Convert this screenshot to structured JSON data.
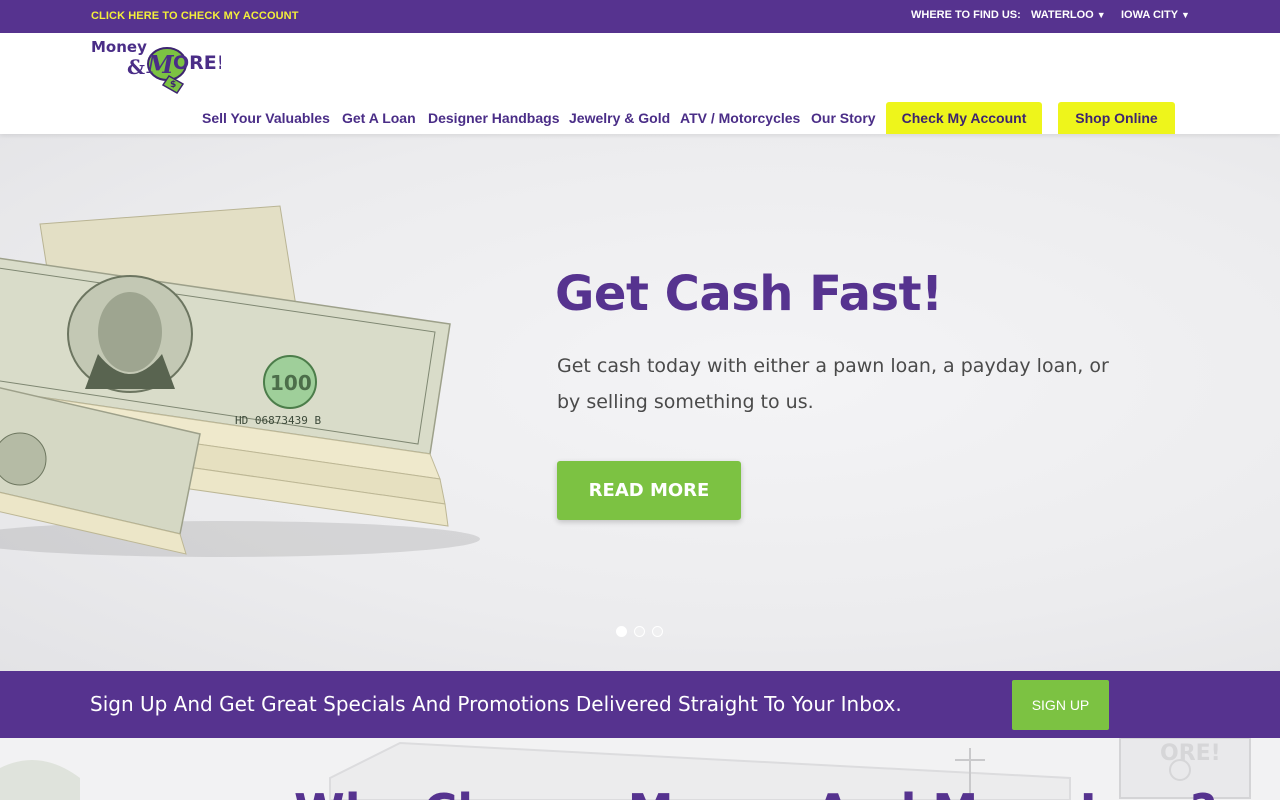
{
  "topbar": {
    "account_link": "CLICK HERE TO CHECK MY ACCOUNT",
    "find_us_label": "WHERE TO FIND US:",
    "locations": [
      {
        "label": "WATERLOO",
        "caret": "▼"
      },
      {
        "label": "IOWA CITY",
        "caret": "▼"
      }
    ]
  },
  "header": {
    "logo": {
      "line1": "Money",
      "amp": "&",
      "line2": "ORE!",
      "m_letter": "M",
      "tag": "$"
    },
    "nav": [
      "Sell Your Valuables",
      "Get A Loan",
      "Designer Handbags",
      "Jewelry & Gold",
      "ATV / Motorcycles",
      "Our Story"
    ],
    "check_account_button": "Check My Account",
    "shop_online_button": "Shop Online"
  },
  "hero": {
    "title": "Get Cash Fast!",
    "subtitle": "Get cash today with either a pawn loan, a payday loan, or by selling something to us.",
    "cta": "READ MORE",
    "bill_numbers": [
      "100",
      "HD 06873439 B"
    ],
    "slides_total": 3,
    "active_slide": 1
  },
  "signup": {
    "text": "Sign Up And Get Great Specials And Promotions Delivered Straight To Your Inbox.",
    "button": "SIGN UP"
  },
  "bottom": {
    "heading": "Why Choose Money And More Inc. ?",
    "sign_text": "ORE!"
  },
  "colors": {
    "brand_purple": "#56338f",
    "accent_yellow": "#eef51b",
    "accent_green": "#7cc242"
  }
}
